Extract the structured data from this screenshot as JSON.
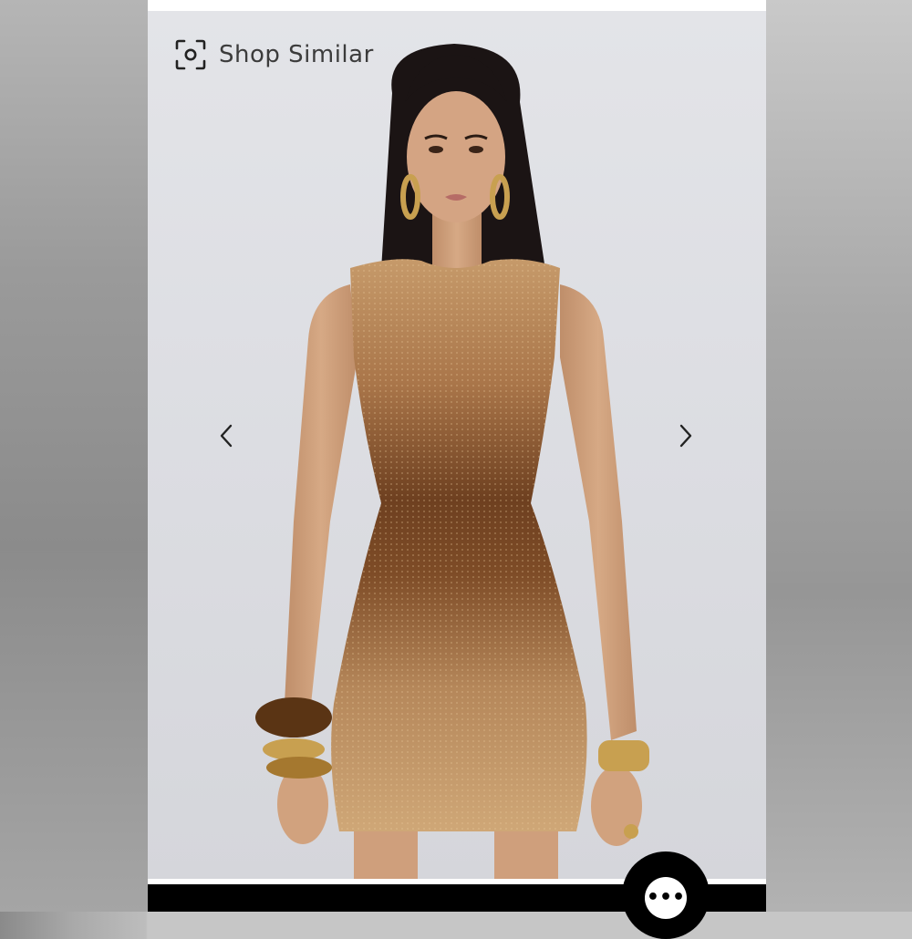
{
  "toolbar": {
    "shop_similar_label": "Shop Similar",
    "shop_similar_icon": "camera-scan-icon"
  },
  "carousel": {
    "prev_icon": "chevron-left-icon",
    "next_icon": "chevron-right-icon"
  },
  "actions": {
    "more_label": "•••",
    "more_icon": "more-dots-icon"
  },
  "colors": {
    "dress_light": "#c9a273",
    "dress_dark": "#6b3d1c",
    "background": "#dcdde2",
    "skin": "#d1a27e",
    "hair": "#1a1414",
    "gold": "#c8a050"
  }
}
